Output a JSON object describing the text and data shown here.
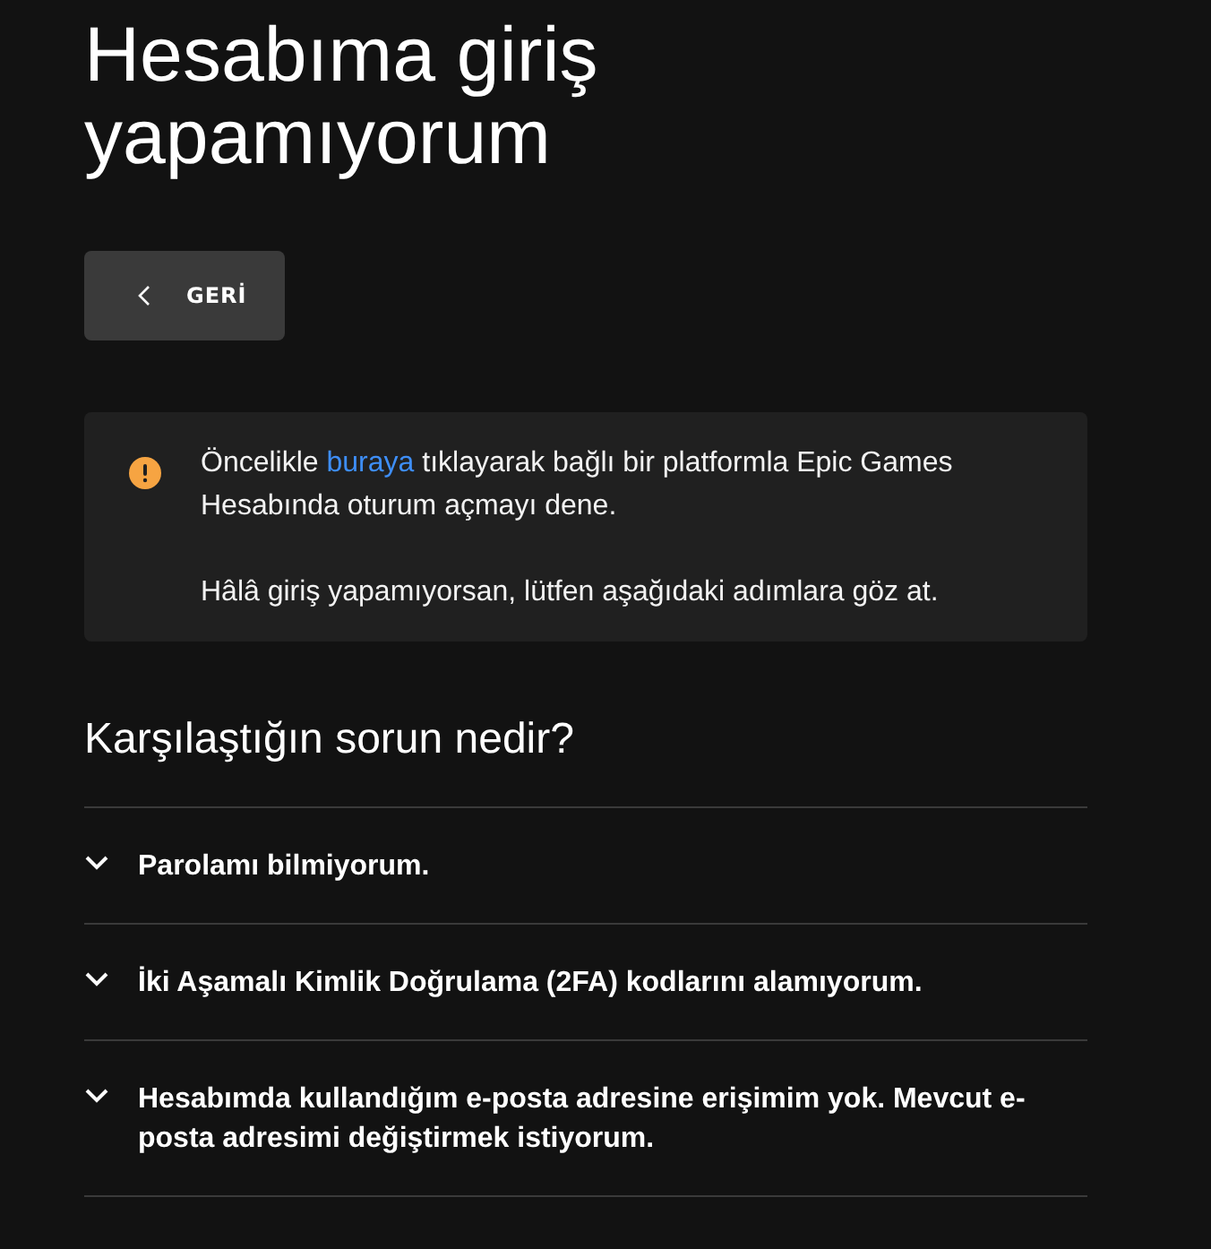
{
  "page_title": "Hesabıma giriş yapamıyorum",
  "back_button": {
    "label": "GERİ"
  },
  "notice": {
    "paragraphs": [
      {
        "before": "Öncelikle ",
        "link": "buraya",
        "after": " tıklayarak bağlı bir platformla Epic Games Hesabında oturum açmayı dene."
      },
      {
        "before": "Hâlâ giriş yapamıyorsan, lütfen aşağıdaki adımlara göz at."
      }
    ]
  },
  "section_heading": "Karşılaştığın sorun nedir?",
  "questions": [
    {
      "label": "Parolamı bilmiyorum.",
      "expanded": false
    },
    {
      "label": "İki Aşamalı Kimlik Doğrulama (2FA) kodlarını alamıyorum.",
      "expanded": false
    },
    {
      "label": "Hesabımda kullandığım e-posta adresine erişimim yok. Mevcut e-posta adresimi değiştirmek istiyorum.",
      "expanded": false
    }
  ]
}
